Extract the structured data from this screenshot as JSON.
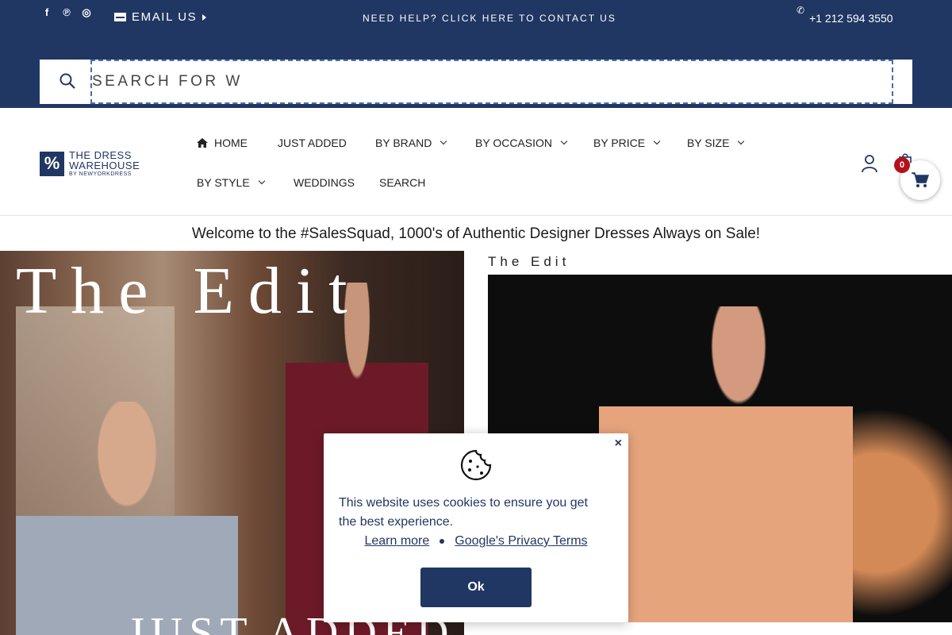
{
  "topbar": {
    "socials": [
      {
        "icon": "facebook-icon",
        "glyph": "f"
      },
      {
        "icon": "pinterest-icon",
        "glyph": "℗"
      },
      {
        "icon": "instagram-icon",
        "glyph": "◎"
      }
    ],
    "email_label": "EMAIL US",
    "help_text": "NEED HELP? CLICK HERE TO CONTACT US",
    "phone": "+1 212 594 3550",
    "background": "#203763"
  },
  "search": {
    "value": "SEARCH FOR W"
  },
  "logo": {
    "mark": "%",
    "line1": "THE DRESS",
    "line2": "WAREHOUSE",
    "line3": "BY NEWYORKDRESS"
  },
  "nav": {
    "items": [
      {
        "label": "HOME",
        "has_dropdown": false,
        "icon": "home-icon"
      },
      {
        "label": "JUST ADDED",
        "has_dropdown": false
      },
      {
        "label": "BY BRAND",
        "has_dropdown": true
      },
      {
        "label": "BY OCCASION",
        "has_dropdown": true
      },
      {
        "label": "BY PRICE",
        "has_dropdown": true
      },
      {
        "label": "BY SIZE",
        "has_dropdown": true
      },
      {
        "label": "BY STYLE",
        "has_dropdown": true
      },
      {
        "label": "WEDDINGS",
        "has_dropdown": false
      },
      {
        "label": "SEARCH",
        "has_dropdown": false
      }
    ]
  },
  "cart": {
    "count": "0",
    "badge_color": "#b3111b"
  },
  "welcome": "Welcome to the #SalesSquad, 1000's of Authentic Designer Dresses Always on Sale!",
  "hero_left": {
    "title": "The Edit",
    "subtitle": "JUST ADDED"
  },
  "hero_right": {
    "label": "The Edit"
  },
  "cookie": {
    "close": "×",
    "message": "This website uses cookies to ensure you get the best experience.",
    "learn_more": "Learn more",
    "privacy": "Google's Privacy Terms",
    "ok": "Ok"
  }
}
